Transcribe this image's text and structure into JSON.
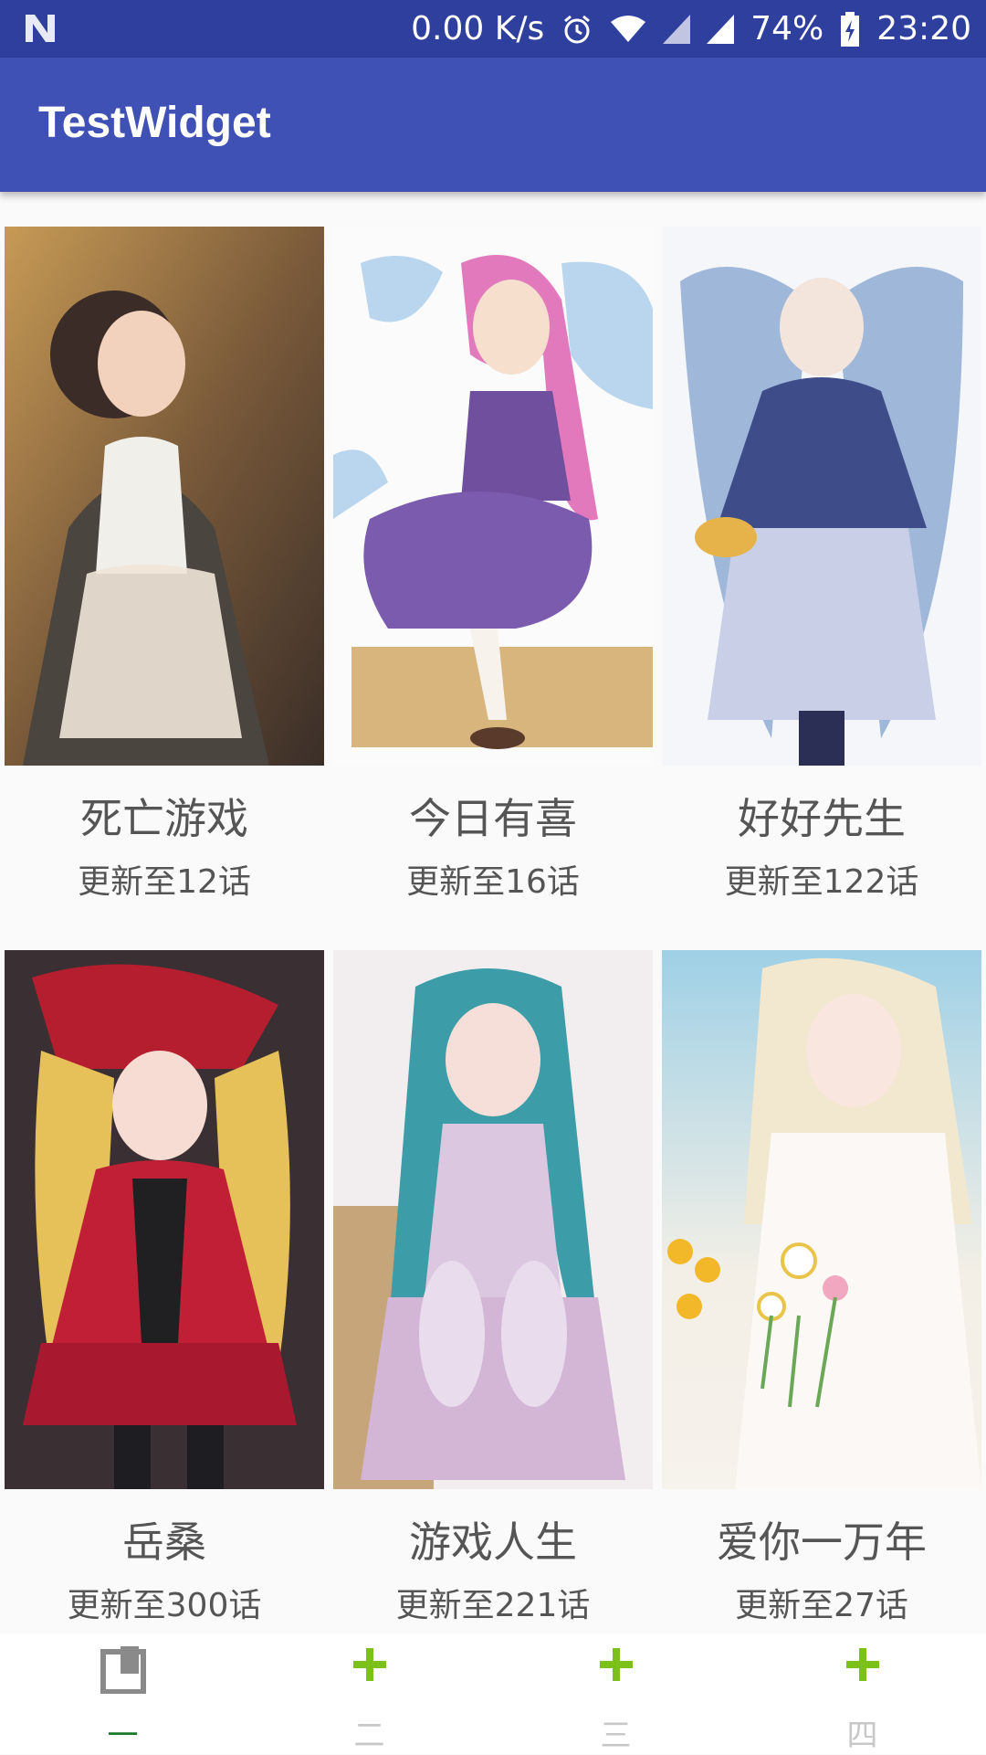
{
  "status_bar": {
    "speed": "0.00 K/s",
    "battery": "74%",
    "time": "23:20",
    "icons": [
      "n-logo-icon",
      "alarm-icon",
      "wifi-icon",
      "signal-icon",
      "signal-icon",
      "battery-charging-icon"
    ]
  },
  "app_bar": {
    "title": "TestWidget",
    "color": "#3f51b5"
  },
  "comics": [
    {
      "title": "死亡游戏",
      "update": "更新至12话",
      "image": "maid-girl-cover"
    },
    {
      "title": "今日有喜",
      "update": "更新至16话",
      "image": "pink-hair-girl-cover"
    },
    {
      "title": "好好先生",
      "update": "更新至122话",
      "image": "blue-twintail-girl-cover"
    },
    {
      "title": "岳桑",
      "update": "更新至300话",
      "image": "red-gothic-girl-cover"
    },
    {
      "title": "游戏人生",
      "update": "更新至221话",
      "image": "teal-hair-girl-cover"
    },
    {
      "title": "爱你一万年",
      "update": "更新至27话",
      "image": "flower-girl-cover"
    }
  ],
  "tabs": [
    {
      "label": "一",
      "icon": "bookmark-icon",
      "active": true
    },
    {
      "label": "二",
      "icon": "plus-icon",
      "active": false
    },
    {
      "label": "三",
      "icon": "plus-icon",
      "active": false
    },
    {
      "label": "四",
      "icon": "plus-icon",
      "active": false
    }
  ],
  "colors": {
    "status_bar": "#2f3f9e",
    "plus_icon": "#7cc11a",
    "active_tab": "#1b7a2a"
  }
}
